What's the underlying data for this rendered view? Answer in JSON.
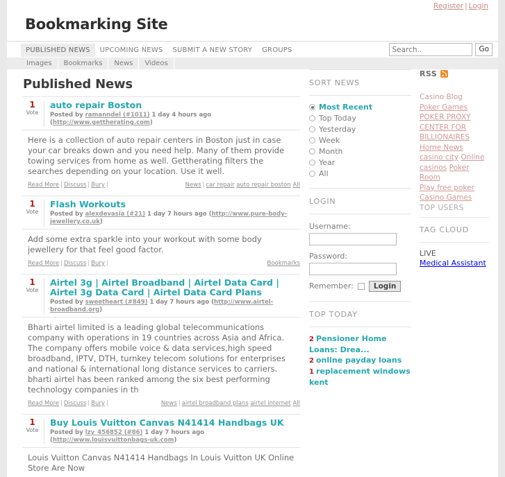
{
  "topbar": {
    "register": "Register",
    "separator": "|",
    "login": "Login"
  },
  "site": {
    "title": "Bookmarking Site"
  },
  "mainnav": {
    "items": [
      {
        "label": "PUBLISHED NEWS",
        "active": true
      },
      {
        "label": "UPCOMING NEWS",
        "active": false
      },
      {
        "label": "SUBMIT A NEW STORY",
        "active": false
      },
      {
        "label": "GROUPS",
        "active": false
      }
    ]
  },
  "search": {
    "placeholder": "Search..",
    "value": "",
    "button": "Go"
  },
  "subnav": {
    "items": [
      "Images",
      "Bookmarks",
      "News",
      "Videos"
    ]
  },
  "main": {
    "page_title": "Published News",
    "rss_label": "RSS",
    "actions": {
      "read_more": "Read More",
      "discuss": "Discuss",
      "bury": "Bury",
      "sep": "|"
    },
    "stories": [
      {
        "votes": "1",
        "vote_label": "Vote",
        "title": "auto repair Boston",
        "posted_by_prefix": "Posted by",
        "author": "ramanndel (#1011)",
        "time": "1 day 4 hours ago",
        "url": "http://www.gettherating.com",
        "body": "Here is a collection of auto repair centers in Boston just in case your car breaks down and you need help. Many of them provide towing services from home as well. Gettherating filters the searches depending on your location. Use it well.",
        "category": "News",
        "tags": [
          "car repair",
          "auto repair boston",
          "All"
        ]
      },
      {
        "votes": "1",
        "vote_label": "Vote",
        "title": "Flash Workouts",
        "posted_by_prefix": "Posted by",
        "author": "alexdevasia (#21)",
        "time": "1 day 7 hours ago",
        "url": "http://www.pure-body-jewellery.co.uk",
        "body": "Add some extra sparkle into your workout with some body jewellery for that feel good factor.",
        "category": "",
        "tags": [
          "Bookmarks"
        ]
      },
      {
        "votes": "1",
        "vote_label": "Vote",
        "title": "Airtel 3g | Airtel Broadband | Airtel Data Card | Airtel 3g Data Card | Airtel Data Card Plans",
        "posted_by_prefix": "Posted by",
        "author": "sweetheart (#849)",
        "time": "1 day 7 hours ago",
        "url": "http://www.airtel-broadband.org",
        "body": "Bharti airtel limited is a leading global telecommunications company with operations in 19 countries across Asia and Africa. The company offers mobile voice & data services,high speed broadband, IPTV, DTH, turnkey telecom solutions for enterprises and national & international long distance services to carriers. bharti airtel has been ranked among the six best performing technology companies in th",
        "category": "News",
        "tags": [
          "airtel broadband plans",
          "airtel internet",
          "All"
        ]
      },
      {
        "votes": "1",
        "vote_label": "Vote",
        "title": "Buy Louis Vuitton Canvas N41414 Handbags UK",
        "posted_by_prefix": "Posted by",
        "author": "lzy_456852 (#86)",
        "time": "1 day 7 hours ago",
        "url": "http://www.louisvuittonbags-uk.com",
        "body": "Louis Vuitton Canvas N41414 Handbags In Louis Vuitton UK Online Store Are Now",
        "category": "",
        "tags": []
      }
    ]
  },
  "sidebar_mid": {
    "sort_news": {
      "title": "SORT NEWS",
      "options": [
        {
          "label": "Most Recent",
          "selected": true
        },
        {
          "label": "Top Today",
          "selected": false
        },
        {
          "label": "Yesterday",
          "selected": false
        },
        {
          "label": "Week",
          "selected": false
        },
        {
          "label": "Month",
          "selected": false
        },
        {
          "label": "Year",
          "selected": false
        },
        {
          "label": "All",
          "selected": false
        }
      ]
    },
    "login": {
      "title": "LOGIN",
      "username_label": "Username:",
      "username_value": "",
      "password_label": "Password:",
      "password_value": "",
      "remember_label": "Remember:",
      "remember_checked": false,
      "button": "Login"
    },
    "top_today": {
      "title": "TOP TODAY",
      "items": [
        {
          "votes": "2",
          "label": "Pensioner Home Loans: Drea..."
        },
        {
          "votes": "2",
          "label": "online payday loans"
        },
        {
          "votes": "1",
          "label": "replacement windows kent"
        }
      ]
    }
  },
  "sidebar_right": {
    "links": [
      "Casino Blog",
      "Poker Games",
      "POKER PROXY",
      "CENTER FOR BILLIONAIRES",
      "Home News",
      "casino city",
      "Online casinos",
      "Poker Room",
      "Play free poker",
      "Casino Games"
    ],
    "top_users_label": "TOP USERS",
    "tag_cloud": {
      "title": "TAG CLOUD"
    },
    "live": {
      "title": "LIVE",
      "link": "Medical Assistant"
    }
  },
  "colors": {
    "accent_teal": "#27a8b0",
    "vote_red": "#b02020",
    "link_pink": "#cf9999",
    "rss_orange": "#f08a24"
  }
}
